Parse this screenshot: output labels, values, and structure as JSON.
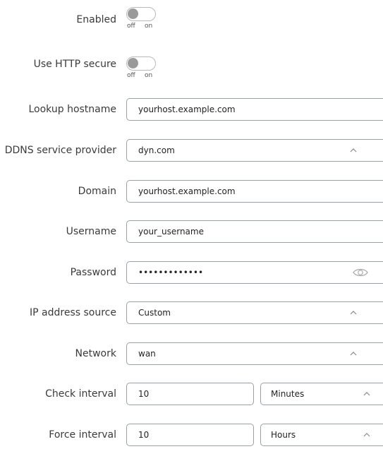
{
  "fields": {
    "enabled": {
      "label": "Enabled",
      "off": "off",
      "on": "on"
    },
    "use_https": {
      "label": "Use HTTP secure",
      "off": "off",
      "on": "on"
    },
    "lookup_hostname": {
      "label": "Lookup hostname",
      "value": "yourhost.example.com"
    },
    "ddns_provider": {
      "label": "DDNS service provider",
      "value": "dyn.com"
    },
    "domain": {
      "label": "Domain",
      "value": "yourhost.example.com"
    },
    "username": {
      "label": "Username",
      "value": "your_username"
    },
    "password": {
      "label": "Password",
      "value": "•••••••••••••"
    },
    "ip_source": {
      "label": "IP address source",
      "value": "Custom"
    },
    "network": {
      "label": "Network",
      "value": "wan"
    },
    "check_interval": {
      "label": "Check interval",
      "value": "10",
      "unit": "Minutes"
    },
    "force_interval": {
      "label": "Force interval",
      "value": "10",
      "unit": "Hours"
    }
  },
  "icons": {
    "chevron": "chevron-up-icon",
    "password_toggle": "eye-icon"
  },
  "colors": {
    "border": "#9aa0a6",
    "label": "#3a3a3a",
    "toggle_knob": "#9a9a9a"
  }
}
